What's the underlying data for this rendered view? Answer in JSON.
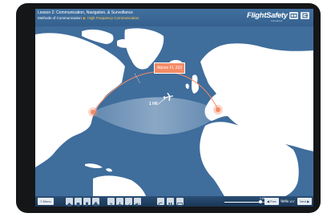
{
  "header": {
    "course_title": "Lesson 2: Communication, Navigation, & Surveillance",
    "breadcrumb_parent": "Methods of Communication",
    "breadcrumb_separator": "▶",
    "breadcrumb_current": "High Frequency Communication",
    "logo": "FlightSafety",
    "logo_subtitle": "international"
  },
  "map": {
    "callout_label": "Above FL 310",
    "hf_label": "1 HF"
  },
  "toolbar": {
    "menu_label": "Menu",
    "time_current": "1:05",
    "time_total": "01:00",
    "slider_progress": 0.72,
    "prev_label": "Prev",
    "page_counter": "12 of 107",
    "next_label": "Next"
  },
  "colors": {
    "ocean": "#3f6d9c",
    "land": "#ffffff",
    "route": "#f58b66",
    "marker": "#f58b66"
  }
}
